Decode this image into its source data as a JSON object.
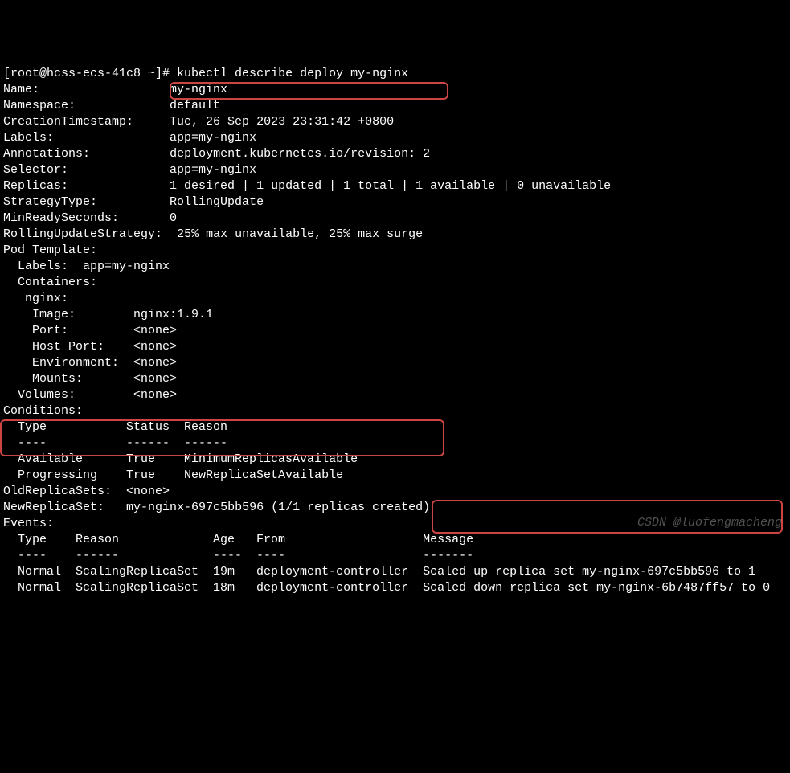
{
  "prompt": "[root@hcss-ecs-41c8 ~]# ",
  "command": "kubectl describe deploy my-nginx",
  "fields": {
    "name_label": "Name:",
    "name_value": "my-nginx",
    "namespace_label": "Namespace:",
    "namespace_value": "default",
    "created_label": "CreationTimestamp:",
    "created_value": "Tue, 26 Sep 2023 23:31:42 +0800",
    "labels_label": "Labels:",
    "labels_value": "app=my-nginx",
    "annotations_label": "Annotations:",
    "annotations_value": "deployment.kubernetes.io/revision: 2",
    "selector_label": "Selector:",
    "selector_value": "app=my-nginx",
    "replicas_label": "Replicas:",
    "replicas_value": "1 desired | 1 updated | 1 total | 1 available | 0 unavailable",
    "strategy_label": "StrategyType:",
    "strategy_value": "RollingUpdate",
    "minready_label": "MinReadySeconds:",
    "minready_value": "0",
    "rolling_label": "RollingUpdateStrategy:",
    "rolling_value": "25% max unavailable, 25% max surge",
    "podtemplate_label": "Pod Template:",
    "pt_labels": "  Labels:  app=my-nginx",
    "pt_containers": "  Containers:",
    "pt_nginx": "   nginx:",
    "pt_image_label": "    Image:",
    "pt_image_value": "nginx:1.9.1",
    "pt_port_label": "    Port:",
    "pt_port_value": "<none>",
    "pt_hostport_label": "    Host Port:",
    "pt_hostport_value": "<none>",
    "pt_env_label": "    Environment:",
    "pt_env_value": "<none>",
    "pt_mounts_label": "    Mounts:",
    "pt_mounts_value": "<none>",
    "pt_volumes_label": "  Volumes:",
    "pt_volumes_value": "<none>",
    "conditions_label": "Conditions:",
    "cond_header": "  Type           Status  Reason",
    "cond_dash": "  ----           ------  ------",
    "cond_avail": "  Available      True    MinimumReplicasAvailable",
    "cond_prog": "  Progressing    True    NewReplicaSetAvailable",
    "oldrs_label": "OldReplicaSets:",
    "oldrs_value": "<none>",
    "newrs_label": "NewReplicaSet:",
    "newrs_value": "my-nginx-697c5bb596 (1/1 replicas created)",
    "events_label": "Events:",
    "ev_header": "  Type    Reason             Age   From                   Message",
    "ev_dash": "  ----    ------             ----  ----                   -------",
    "ev_row1": "  Normal  ScalingReplicaSet  19m   deployment-controller  Scaled up replica set my-nginx-697c5bb596 to 1",
    "ev_row2": "  Normal  ScalingReplicaSet  18m   deployment-controller  Scaled down replica set my-nginx-6b7487ff57 to 0"
  },
  "watermark": "CSDN @luofengmacheng"
}
